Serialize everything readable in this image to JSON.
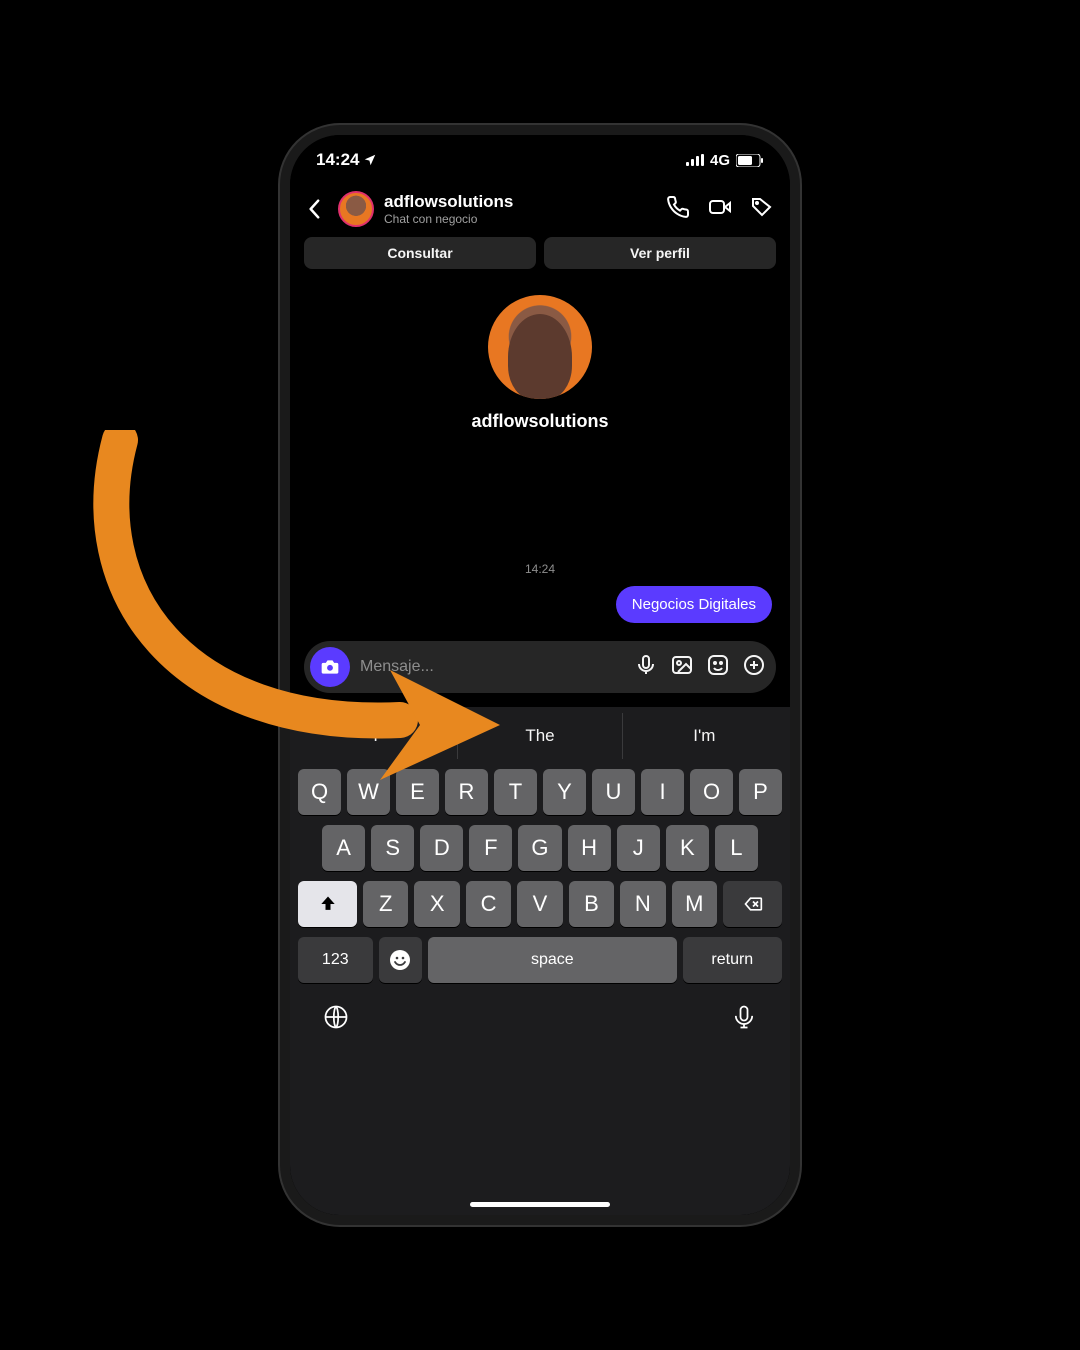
{
  "statusbar": {
    "time": "14:24",
    "network": "4G"
  },
  "header": {
    "username": "adflowsolutions",
    "subtitle": "Chat con negocio"
  },
  "pills": {
    "consult": "Consultar",
    "profile": "Ver perfil"
  },
  "profile": {
    "name": "adflowsolutions"
  },
  "chat": {
    "timestamp": "14:24",
    "message": "Negocios Digitales"
  },
  "input": {
    "placeholder": "Mensaje..."
  },
  "keyboard": {
    "suggestions": [
      "I",
      "The",
      "I'm"
    ],
    "row1": [
      "Q",
      "W",
      "E",
      "R",
      "T",
      "Y",
      "U",
      "I",
      "O",
      "P"
    ],
    "row2": [
      "A",
      "S",
      "D",
      "F",
      "G",
      "H",
      "J",
      "K",
      "L"
    ],
    "row3": [
      "Z",
      "X",
      "C",
      "V",
      "B",
      "N",
      "M"
    ],
    "numbers": "123",
    "space": "space",
    "return": "return"
  }
}
